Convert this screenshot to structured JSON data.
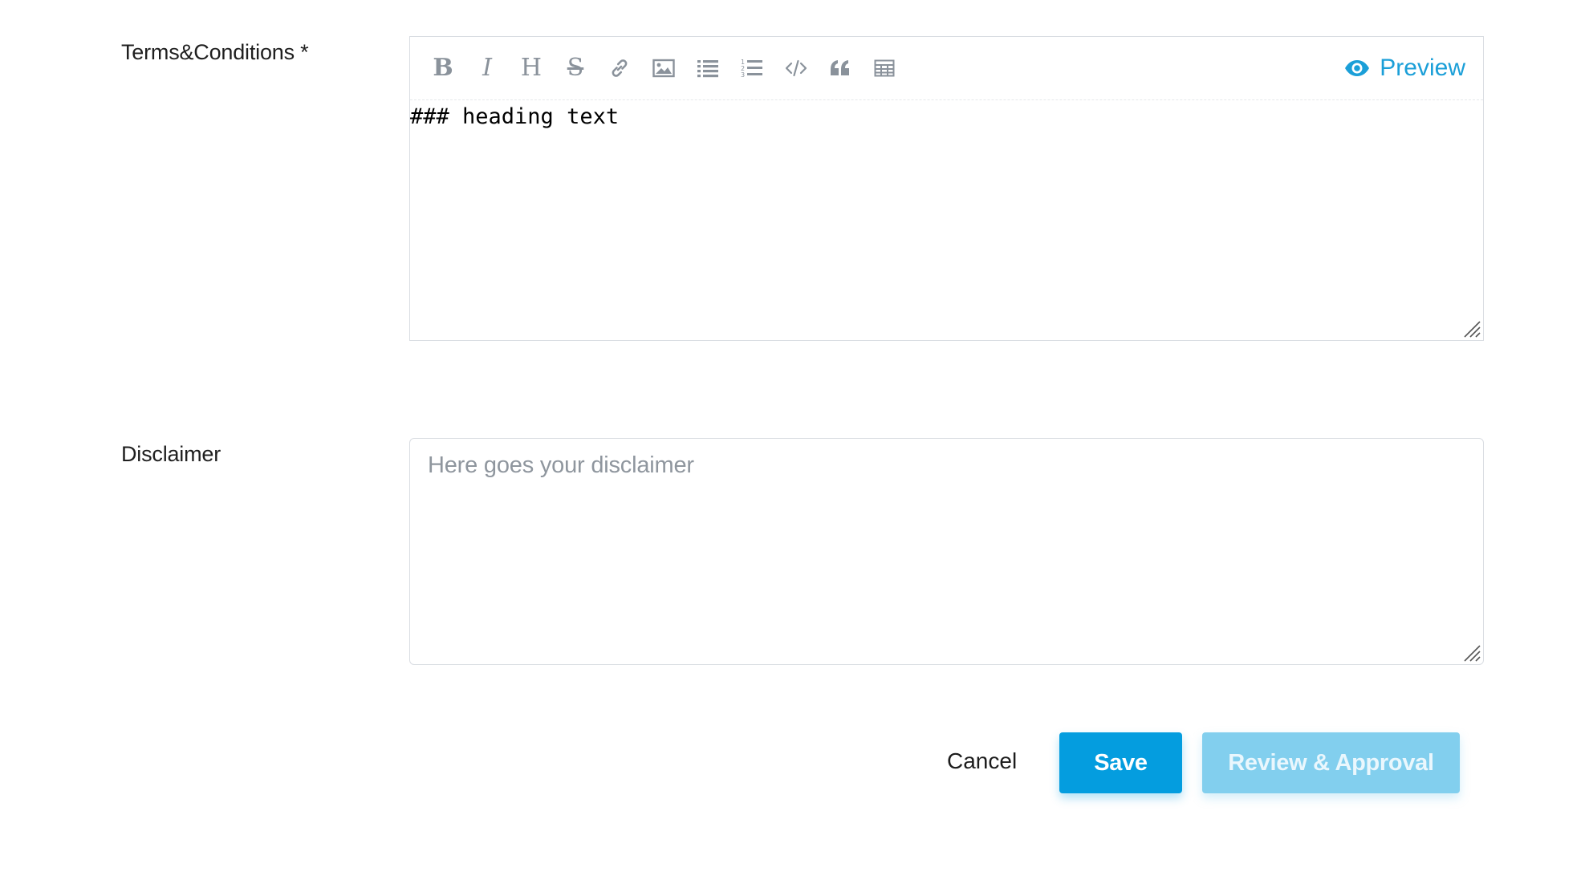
{
  "terms": {
    "label": "Terms&Conditions *",
    "editor_value": "### heading text",
    "toolbar": {
      "bold_glyph": "B",
      "italic_glyph": "I",
      "heading_glyph": "H",
      "strike_glyph": "S",
      "icons": [
        "bold-icon",
        "italic-icon",
        "heading-icon",
        "strikethrough-icon",
        "link-icon",
        "image-icon",
        "unordered-list-icon",
        "ordered-list-icon",
        "code-icon",
        "quote-icon",
        "table-icon"
      ],
      "preview_label": "Preview"
    }
  },
  "disclaimer": {
    "label": "Disclaimer",
    "placeholder": "Here goes your disclaimer"
  },
  "actions": {
    "cancel_label": "Cancel",
    "save_label": "Save",
    "review_label": "Review & Approval"
  },
  "colors": {
    "accent": "#049ddf",
    "accent_disabled": "#82cfee",
    "preview_link": "#1b9fd8",
    "toolbar_icon": "#8a929b",
    "border": "#d9dde2",
    "placeholder": "#8f969e"
  }
}
